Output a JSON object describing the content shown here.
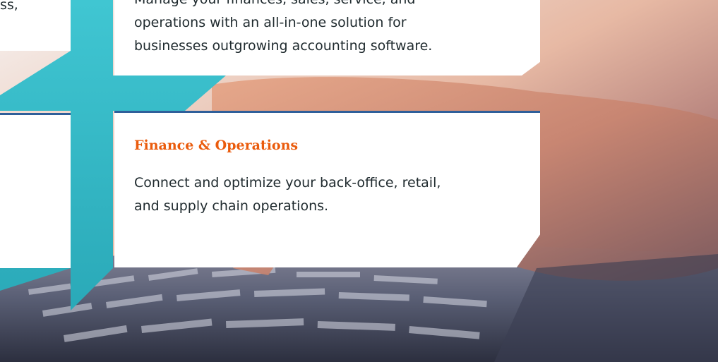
{
  "left_panel": {
    "top_text_fragment": "ss,"
  },
  "top_card": {
    "lines": [
      "Manage your finances, sales, service, and",
      "operations with an all-in-one solution for",
      "businesses outgrowing accounting software."
    ]
  },
  "bottom_card": {
    "title": "Finance & Operations",
    "lines": [
      "Connect and optimize your back-office, retail,",
      "and supply chain operations."
    ]
  },
  "colors": {
    "accent_title": "#ea5b0c",
    "teal_cross": "#35b8c6",
    "divider": "#2f5f9a"
  }
}
